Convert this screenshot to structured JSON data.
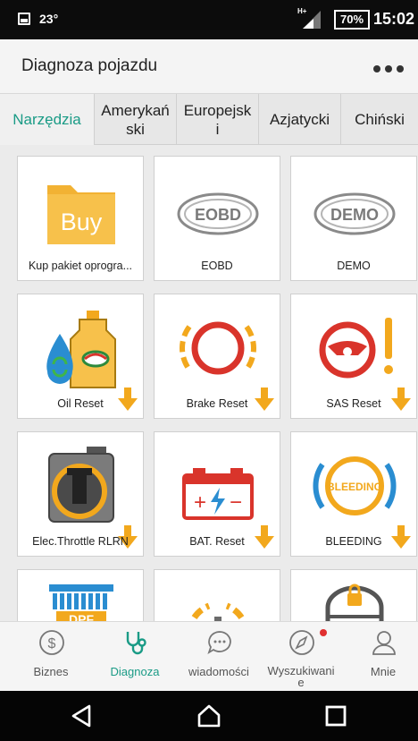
{
  "status_bar": {
    "temperature": "23°",
    "network": "H+",
    "battery": "70%",
    "time": "15:02"
  },
  "header": {
    "title": "Diagnoza pojazdu",
    "menu_icon": "more-horizontal-icon"
  },
  "tabs": [
    {
      "label": "Narzędzia",
      "active": true
    },
    {
      "label": "Amerykań\nski",
      "active": false
    },
    {
      "label": "Europejsk\ni",
      "active": false
    },
    {
      "label": "Azjatycki",
      "active": false
    },
    {
      "label": "Chiński",
      "active": false
    }
  ],
  "cards": [
    {
      "label": "Kup pakiet oprogra...",
      "icon": "buy-folder-icon",
      "badge": "Buy",
      "download": false
    },
    {
      "label": "EOBD",
      "icon": "eobd-badge-icon",
      "badge": "EOBD",
      "download": false
    },
    {
      "label": "DEMO",
      "icon": "demo-badge-icon",
      "badge": "DEMO",
      "download": false
    },
    {
      "label": "Oil Reset",
      "icon": "oil-reset-icon",
      "download": true
    },
    {
      "label": "Brake Reset",
      "icon": "brake-reset-icon",
      "download": true
    },
    {
      "label": "SAS Reset",
      "icon": "steering-warning-icon",
      "download": true
    },
    {
      "label": "Elec.Throttle RLRN",
      "icon": "throttle-body-icon",
      "download": true
    },
    {
      "label": "BAT. Reset",
      "icon": "battery-reset-icon",
      "download": true
    },
    {
      "label": "BLEEDING",
      "icon": "bleeding-icon",
      "badge": "BLEEDING",
      "download": true
    },
    {
      "label": "",
      "icon": "dpf-icon",
      "badge": "DPF",
      "download": false
    },
    {
      "label": "",
      "icon": "tpms-gear-icon",
      "download": false
    },
    {
      "label": "",
      "icon": "immobilizer-icon",
      "download": false
    }
  ],
  "bottom_nav": [
    {
      "label": "Biznes",
      "icon": "dollar-icon",
      "active": false
    },
    {
      "label": "Diagnoza",
      "icon": "stethoscope-icon",
      "active": true
    },
    {
      "label": "wiadomości",
      "icon": "chat-bubble-icon",
      "active": false
    },
    {
      "label": "Wyszukiwani\ne",
      "icon": "compass-icon",
      "active": false,
      "notification": true
    },
    {
      "label": "Mnie",
      "icon": "person-icon",
      "active": false
    }
  ],
  "system_nav": [
    "back-icon",
    "home-icon",
    "recents-icon"
  ],
  "colors": {
    "accent": "#1a9b86",
    "orange": "#f2a81d",
    "red": "#d9342b",
    "icon_grey": "#8a8a8a"
  }
}
